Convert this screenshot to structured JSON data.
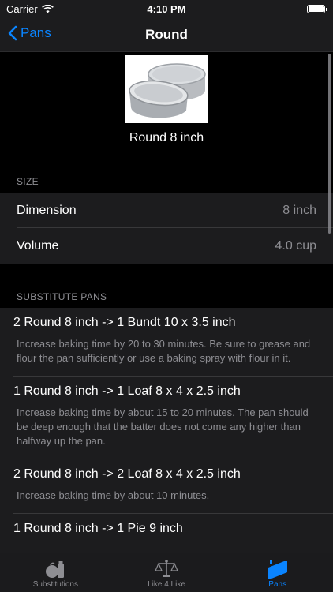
{
  "status": {
    "carrier": "Carrier",
    "time": "4:10 PM"
  },
  "nav": {
    "back_label": "Pans",
    "title": "Round"
  },
  "pan": {
    "name": "Round 8 inch"
  },
  "size_section": {
    "header": "SIZE",
    "rows": [
      {
        "label": "Dimension",
        "value": "8 inch"
      },
      {
        "label": "Volume",
        "value": "4.0 cup"
      }
    ]
  },
  "substitutes_section": {
    "header": "SUBSTITUTE PANS",
    "items": [
      {
        "title": "2 Round 8 inch -> 1 Bundt 10 x 3.5 inch",
        "desc": "Increase baking time by 20 to 30 minutes. Be sure to grease and flour the pan sufficiently or use a baking spray with flour in it."
      },
      {
        "title": "1 Round 8 inch -> 1 Loaf 8 x 4 x 2.5 inch",
        "desc": "Increase baking time by about 15 to 20 minutes. The pan should be deep enough that the batter does not come any higher than halfway up the pan."
      },
      {
        "title": "2 Round 8 inch -> 2 Loaf 8 x 4 x 2.5 inch",
        "desc": "Increase baking time by about 10 minutes."
      },
      {
        "title": "1 Round 8 inch -> 1 Pie 9 inch",
        "desc": ""
      }
    ]
  },
  "tabs": [
    {
      "label": "Substitutions",
      "icon": "substitutions-icon",
      "active": false
    },
    {
      "label": "Like 4 Like",
      "icon": "scale-icon",
      "active": false
    },
    {
      "label": "Pans",
      "icon": "pans-icon",
      "active": true
    }
  ],
  "colors": {
    "accent": "#0a84ff",
    "background": "#000000",
    "cell": "#1c1c1e",
    "secondary_text": "#8e8e93"
  }
}
